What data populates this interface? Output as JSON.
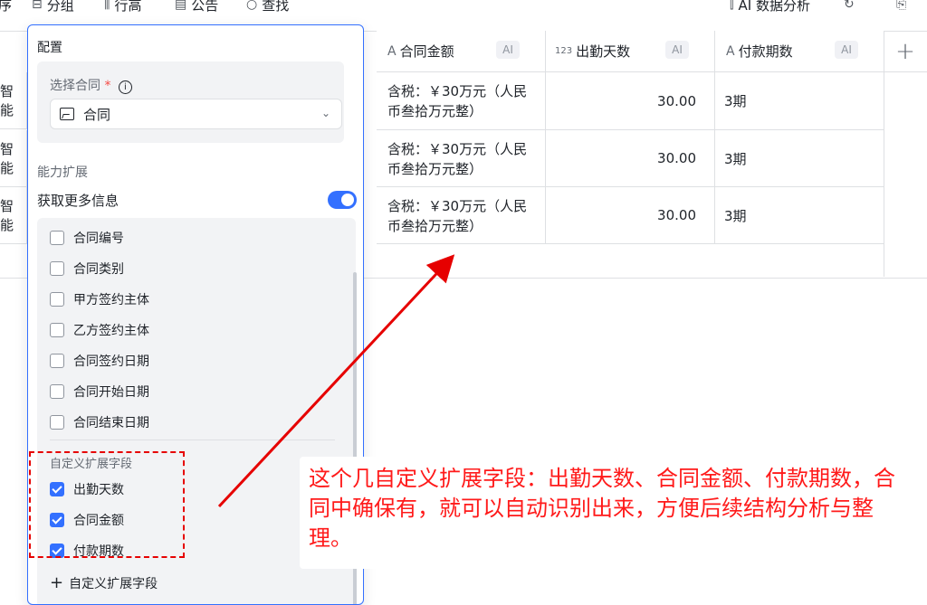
{
  "toolbar": {
    "items": [
      "序",
      "分组",
      "行高",
      "公告",
      "查找"
    ],
    "right_ai": "AI 数据分析"
  },
  "table": {
    "columns": [
      {
        "icon": "text-field-icon",
        "label": "合同金额",
        "ai": "AI"
      },
      {
        "icon": "number-field-icon",
        "label": "出勤天数",
        "ai": "AI"
      },
      {
        "icon": "text-field-icon",
        "label": "付款期数",
        "ai": "AI"
      }
    ],
    "left_fragment": "智能",
    "rows": [
      {
        "amount": "含税：￥30万元（人民币叁拾万元整）",
        "days": "30.00",
        "periods": "3期"
      },
      {
        "amount": "含税：￥30万元（人民币叁拾万元整）",
        "days": "30.00",
        "periods": "3期"
      },
      {
        "amount": "含税：￥30万元（人民币叁拾万元整）",
        "days": "30.00",
        "periods": "3期"
      }
    ],
    "add_column": "+"
  },
  "panel": {
    "title": "配置",
    "select_contract": {
      "label": "选择合同",
      "required_mark": "*",
      "info": "i",
      "value": "合同",
      "chevron": "⌄"
    },
    "extension_title": "能力扩展",
    "get_more": {
      "label": "获取更多信息",
      "enabled": true
    },
    "fields": [
      {
        "label": "合同编号",
        "checked": false
      },
      {
        "label": "合同类别",
        "checked": false
      },
      {
        "label": "甲方签约主体",
        "checked": false
      },
      {
        "label": "乙方签约主体",
        "checked": false
      },
      {
        "label": "合同签约日期",
        "checked": false
      },
      {
        "label": "合同开始日期",
        "checked": false
      },
      {
        "label": "合同结束日期",
        "checked": false
      }
    ],
    "custom_title": "自定义扩展字段",
    "custom_fields": [
      {
        "label": "出勤天数",
        "checked": true
      },
      {
        "label": "合同金额",
        "checked": true
      },
      {
        "label": "付款期数",
        "checked": true
      }
    ],
    "add_custom": "自定义扩展字段"
  },
  "annotation": {
    "text": "这个几自定义扩展字段：出勤天数、合同金额、付款期数，合同中确保有，就可以自动识别出来，方便后续结构分析与整理。",
    "color": "#ff1a1a"
  },
  "colors": {
    "accent": "#3370ff",
    "annotation_red": "#e60000"
  }
}
